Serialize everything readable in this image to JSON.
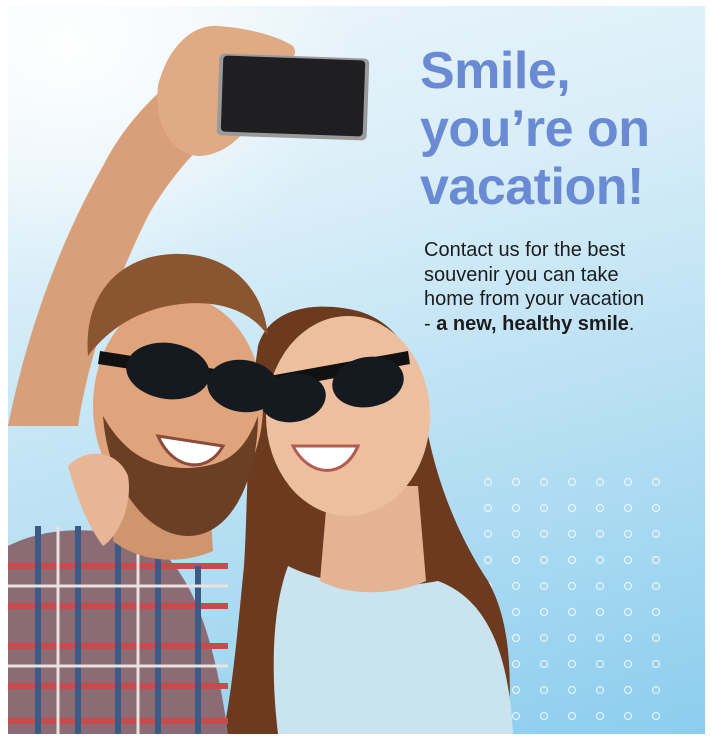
{
  "headline": {
    "line1": "Smile,",
    "line2": "you’re on",
    "line3": "vacation!"
  },
  "body": {
    "line1": "Contact us for the best",
    "line2": "souvenir you can take",
    "line3": "home from your vacation",
    "line4_prefix": "- ",
    "line4_bold": "a new, healthy smile",
    "line4_suffix": "."
  },
  "colors": {
    "headline": "#6a8bd3",
    "body_text": "#1c1c1e",
    "sky": "#8ccdee",
    "dot_pattern": "#ffffff"
  },
  "images": {
    "main_photo": "couple-selfie-photo",
    "phone": "smartphone"
  }
}
